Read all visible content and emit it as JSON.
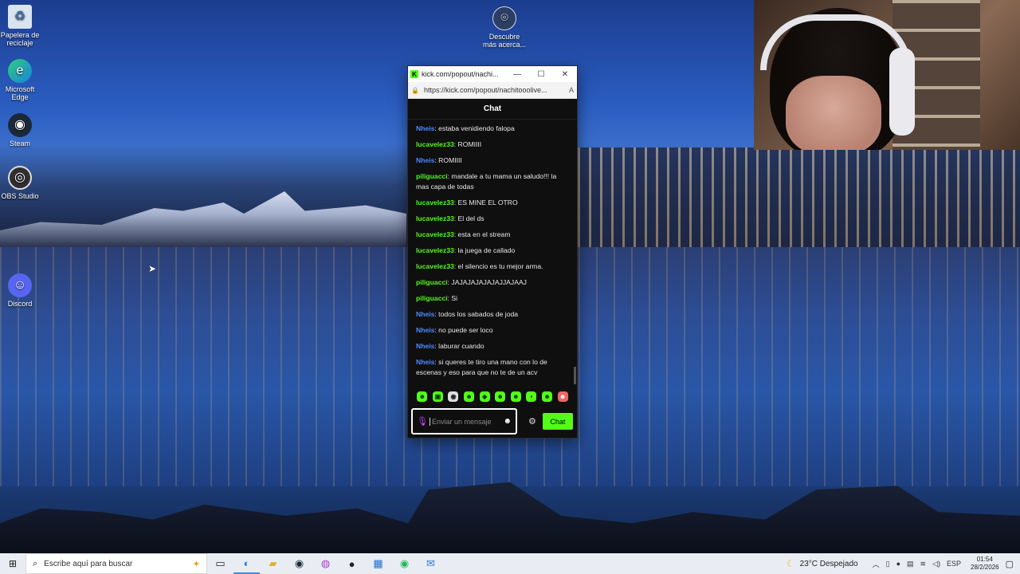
{
  "desktop": {
    "icons": [
      {
        "label": "Papelera de reciclaje",
        "icon": "recycle-bin-icon"
      },
      {
        "label": "Microsoft Edge",
        "icon": "edge-icon"
      },
      {
        "label": "Steam",
        "icon": "steam-icon"
      },
      {
        "label": "OBS Studio",
        "icon": "obs-icon"
      },
      {
        "label": "Discord",
        "icon": "discord-icon"
      },
      {
        "label": "Descubre más acerca...",
        "icon": "spotlight-icon"
      }
    ]
  },
  "popout": {
    "tab_title": "kick.com/popout/nachi...",
    "url": "https://kick.com/popout/nachitooolive...",
    "header": "Chat",
    "messages": [
      {
        "user": "Nheis",
        "text": ": estaba venidiendo falopa",
        "color": "#4a8cff"
      },
      {
        "user": "lucavelez33",
        "text": ": ROMIIII",
        "color": "#53fc18"
      },
      {
        "user": "Nheis",
        "text": ": ROMIIII",
        "color": "#4a8cff"
      },
      {
        "user": "piliguacci",
        "text": ": mandale a tu mama un saludo!!! la mas capa de todas",
        "color": "#53fc18"
      },
      {
        "user": "lucavelez33",
        "text": ": ES MINE EL OTRO",
        "color": "#53fc18"
      },
      {
        "user": "lucavelez33",
        "text": ": El del ds",
        "color": "#53fc18"
      },
      {
        "user": "lucavelez33",
        "text": ": esta en el stream",
        "color": "#53fc18"
      },
      {
        "user": "lucavelez33",
        "text": ": la juega de callado",
        "color": "#53fc18"
      },
      {
        "user": "lucavelez33",
        "text": ": el silencio es tu mejor arma.",
        "color": "#53fc18"
      },
      {
        "user": "piliguacci",
        "text": ": JAJAJAJAJAJAJJAJAAJ",
        "color": "#53fc18"
      },
      {
        "user": "piliguacci",
        "text": ": Si",
        "color": "#53fc18"
      },
      {
        "user": "Nheis",
        "text": ": todos los sabados de joda",
        "color": "#4a8cff"
      },
      {
        "user": "Nheis",
        "text": ": no puede ser loco",
        "color": "#4a8cff"
      },
      {
        "user": "Nheis",
        "text": ": laburar cuando",
        "color": "#4a8cff"
      },
      {
        "user": "Nheis",
        "text": ": si queres te tiro una mano con lo de escenas y eso para que no te de un acv",
        "color": "#4a8cff"
      }
    ],
    "input_placeholder": "Enviar un mensaje",
    "send_label": "Chat",
    "accent": "#53fc18"
  },
  "taskbar": {
    "search_placeholder": "Escribe aquí para buscar",
    "weather": "23°C  Despejado",
    "lang": "ESP",
    "time": "01:54",
    "date": "28/2/2026"
  }
}
